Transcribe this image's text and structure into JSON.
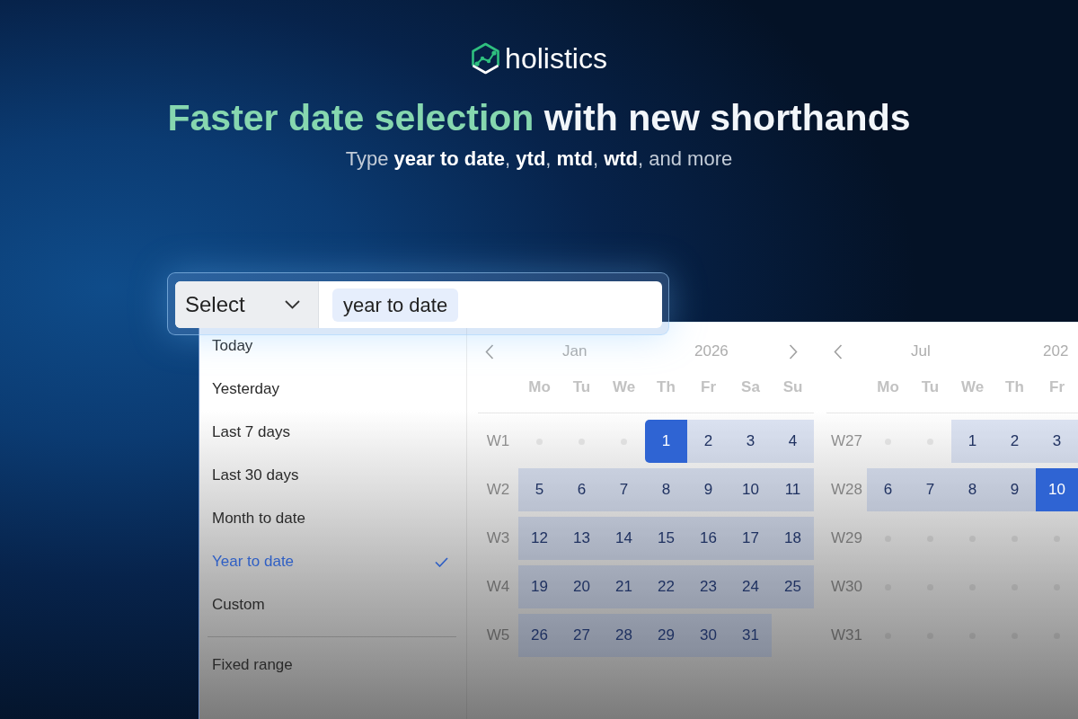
{
  "logo": {
    "text": "holistics"
  },
  "headline": {
    "accent": "Faster date selection",
    "text": "with new shorthands"
  },
  "subtitle": "Type **year to date**, **ytd**, **mtd**, **wtd**, and more",
  "date_filter": {
    "mode_select": {
      "value": "Select"
    },
    "chip": "year to date"
  },
  "presets": [
    {
      "label": "Today",
      "selected": false
    },
    {
      "label": "Yesterday",
      "selected": false
    },
    {
      "label": "Last 7 days",
      "selected": false
    },
    {
      "label": "Last 30 days",
      "selected": false
    },
    {
      "label": "Month to date",
      "selected": false
    },
    {
      "label": "Year to date",
      "selected": true
    },
    {
      "label": "Custom",
      "selected": false
    }
  ],
  "more_presets": [
    {
      "label": "Fixed range",
      "selected": false
    }
  ],
  "calendars": [
    {
      "month": "Jan",
      "year": "2026",
      "has_prev": true,
      "has_next": true,
      "weekdays": [
        "Mo",
        "Tu",
        "We",
        "Th",
        "Fr",
        "Sa",
        "Su"
      ],
      "weeks": [
        {
          "label": "W1",
          "days": [
            {
              "kind": "dot"
            },
            {
              "kind": "dot"
            },
            {
              "kind": "dot"
            },
            {
              "kind": "day",
              "text": "1",
              "in_range": true,
              "selected": true
            },
            {
              "kind": "day",
              "text": "2",
              "in_range": true,
              "selected": false
            },
            {
              "kind": "day",
              "text": "3",
              "in_range": true,
              "selected": false
            },
            {
              "kind": "day",
              "text": "4",
              "in_range": true,
              "selected": false
            }
          ]
        },
        {
          "label": "W2",
          "days": [
            {
              "kind": "day",
              "text": "5",
              "in_range": true,
              "selected": false
            },
            {
              "kind": "day",
              "text": "6",
              "in_range": true,
              "selected": false
            },
            {
              "kind": "day",
              "text": "7",
              "in_range": true,
              "selected": false
            },
            {
              "kind": "day",
              "text": "8",
              "in_range": true,
              "selected": false
            },
            {
              "kind": "day",
              "text": "9",
              "in_range": true,
              "selected": false
            },
            {
              "kind": "day",
              "text": "10",
              "in_range": true,
              "selected": false
            },
            {
              "kind": "day",
              "text": "11",
              "in_range": true,
              "selected": false
            }
          ]
        },
        {
          "label": "W3",
          "days": [
            {
              "kind": "day",
              "text": "12",
              "in_range": true,
              "selected": false
            },
            {
              "kind": "day",
              "text": "13",
              "in_range": true,
              "selected": false
            },
            {
              "kind": "day",
              "text": "14",
              "in_range": true,
              "selected": false
            },
            {
              "kind": "day",
              "text": "15",
              "in_range": true,
              "selected": false
            },
            {
              "kind": "day",
              "text": "16",
              "in_range": true,
              "selected": false
            },
            {
              "kind": "day",
              "text": "17",
              "in_range": true,
              "selected": false
            },
            {
              "kind": "day",
              "text": "18",
              "in_range": true,
              "selected": false
            }
          ]
        },
        {
          "label": "W4",
          "days": [
            {
              "kind": "day",
              "text": "19",
              "in_range": true,
              "selected": false
            },
            {
              "kind": "day",
              "text": "20",
              "in_range": true,
              "selected": false
            },
            {
              "kind": "day",
              "text": "21",
              "in_range": true,
              "selected": false
            },
            {
              "kind": "day",
              "text": "22",
              "in_range": true,
              "selected": false
            },
            {
              "kind": "day",
              "text": "23",
              "in_range": true,
              "selected": false
            },
            {
              "kind": "day",
              "text": "24",
              "in_range": true,
              "selected": false
            },
            {
              "kind": "day",
              "text": "25",
              "in_range": true,
              "selected": false
            }
          ]
        },
        {
          "label": "W5",
          "days": [
            {
              "kind": "day",
              "text": "26",
              "in_range": true,
              "selected": false
            },
            {
              "kind": "day",
              "text": "27",
              "in_range": true,
              "selected": false
            },
            {
              "kind": "day",
              "text": "28",
              "in_range": true,
              "selected": false
            },
            {
              "kind": "day",
              "text": "29",
              "in_range": true,
              "selected": false
            },
            {
              "kind": "day",
              "text": "30",
              "in_range": true,
              "selected": false
            },
            {
              "kind": "day",
              "text": "31",
              "in_range": true,
              "selected": false
            }
          ]
        }
      ]
    },
    {
      "month": "Jul",
      "year": "202",
      "has_prev": true,
      "weekdays": [
        "Mo",
        "Tu",
        "We",
        "Th",
        "Fr"
      ],
      "weeks": [
        {
          "label": "W27",
          "days": [
            {
              "kind": "dot"
            },
            {
              "kind": "dot"
            },
            {
              "kind": "day",
              "text": "1",
              "in_range": true,
              "selected": false
            },
            {
              "kind": "day",
              "text": "2",
              "in_range": true,
              "selected": false
            },
            {
              "kind": "day",
              "text": "3",
              "in_range": true,
              "selected": false
            }
          ]
        },
        {
          "label": "W28",
          "days": [
            {
              "kind": "day",
              "text": "6",
              "in_range": true,
              "selected": false
            },
            {
              "kind": "day",
              "text": "7",
              "in_range": true,
              "selected": false
            },
            {
              "kind": "day",
              "text": "8",
              "in_range": true,
              "selected": false
            },
            {
              "kind": "day",
              "text": "9",
              "in_range": true,
              "selected": false
            },
            {
              "kind": "day",
              "text": "10",
              "in_range": true,
              "selected": true
            }
          ]
        },
        {
          "label": "W29",
          "days": [
            {
              "kind": "dot"
            },
            {
              "kind": "dot"
            },
            {
              "kind": "dot"
            },
            {
              "kind": "dot"
            },
            {
              "kind": "dot"
            }
          ]
        },
        {
          "label": "W30",
          "days": [
            {
              "kind": "dot"
            },
            {
              "kind": "dot"
            },
            {
              "kind": "dot"
            },
            {
              "kind": "dot"
            },
            {
              "kind": "dot"
            }
          ]
        },
        {
          "label": "W31",
          "days": [
            {
              "kind": "dot"
            },
            {
              "kind": "dot"
            },
            {
              "kind": "dot"
            },
            {
              "kind": "dot"
            },
            {
              "kind": "dot"
            }
          ]
        }
      ]
    }
  ]
}
